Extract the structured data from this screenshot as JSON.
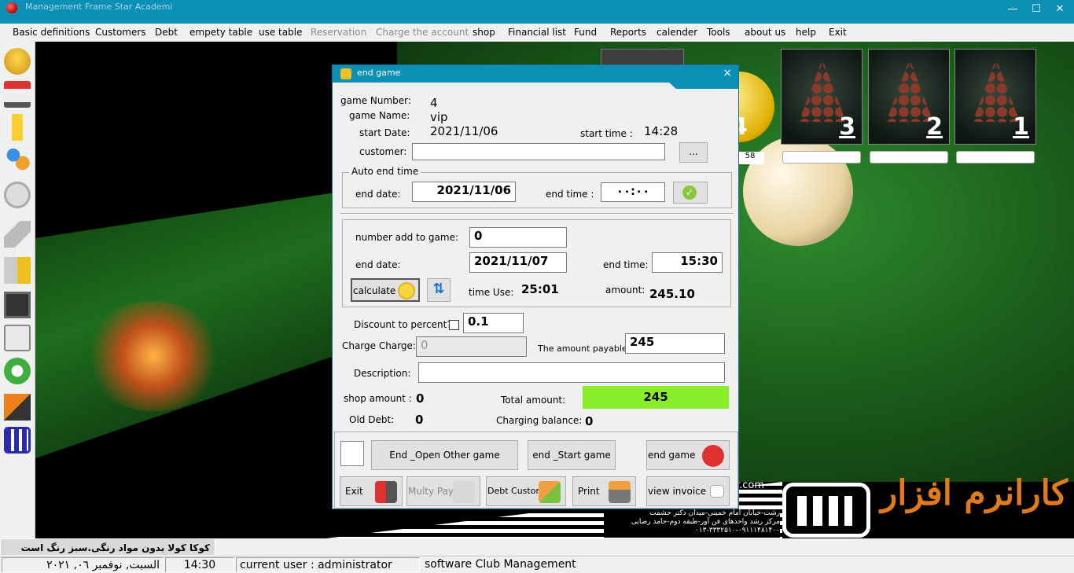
{
  "window": {
    "title": "Management Frame Star Academi",
    "minimize": "—",
    "maximize": "☐",
    "close": "✕"
  },
  "menu": [
    {
      "label": "Basic definitions",
      "enabled": true
    },
    {
      "label": "Customers",
      "enabled": true
    },
    {
      "label": "Debt",
      "enabled": true
    },
    {
      "label": "empety table",
      "enabled": true
    },
    {
      "label": "use table",
      "enabled": true
    },
    {
      "label": "Reservation",
      "enabled": false
    },
    {
      "label": "Charge the account",
      "enabled": false
    },
    {
      "label": "shop",
      "enabled": true
    },
    {
      "label": "Financial list",
      "enabled": true
    },
    {
      "label": "Fund",
      "enabled": true
    },
    {
      "label": "Reports",
      "enabled": true
    },
    {
      "label": "calender",
      "enabled": true
    },
    {
      "label": "Tools",
      "enabled": true
    },
    {
      "label": "about us",
      "enabled": true
    },
    {
      "label": "help",
      "enabled": true
    },
    {
      "label": "Exit",
      "enabled": true
    }
  ],
  "toolbar_icons": [
    "coins-icon",
    "shopping-cart-icon",
    "drink-icon",
    "users-icon",
    "clock-icon",
    "tag-icon",
    "customer-report-icon",
    "save-icon",
    "calculator-icon",
    "refresh-icon",
    "k-logo-icon",
    "brand-logo-icon"
  ],
  "tables": [
    {
      "number": "3"
    },
    {
      "number": "2"
    },
    {
      "number": "1"
    }
  ],
  "partial_table": {
    "number": "4",
    "label": "58"
  },
  "dialog": {
    "title": "end game",
    "close": "×",
    "game_number_label": "game Number:",
    "game_number": "4",
    "game_name_label": "game Name:",
    "game_name": "vip",
    "start_date_label": "start Date:",
    "start_date": "2021/11/06",
    "start_time_label": "start time :",
    "start_time": "14:28",
    "customer_label": "customer:",
    "customer_value": "",
    "browse_label": "...",
    "auto_end": {
      "legend": "Auto end time",
      "end_date_label": "end date:",
      "end_date": "2021/11/06",
      "end_time_label": "end time :",
      "end_time": "۰۰:۰۰"
    },
    "calc": {
      "number_add_label": "number add to game:",
      "number_add": "0",
      "end_date_label": "end date:",
      "end_date": "2021/11/07",
      "end_time_label": "end time:",
      "end_time": "15:30",
      "calculate_label": "calculate",
      "time_use_label": "time Use:",
      "time_use": "25:01",
      "amount_label": "amount:",
      "amount": "245.10"
    },
    "discount_label": "Discount to percent?",
    "discount_value": "0.1",
    "charge_label": "Charge Charge:",
    "charge_value": "0",
    "payable_label": "The amount payable:",
    "payable_value": "245",
    "description_label": "Description:",
    "description_value": "",
    "shop_amount_label": "shop amount :",
    "shop_amount": "0",
    "total_label": "Total amount:",
    "total_value": "245",
    "old_debt_label": "Old Debt:",
    "old_debt": "0",
    "charging_balance_label": "Charging balance:",
    "charging_balance": "0",
    "buttons": {
      "end_open_other": "End _Open Other game",
      "end_start": "end _Start game",
      "end_game": "end game",
      "exit": "Exit",
      "multy_pay": "Multy Pay",
      "debt_customer": "Debt Customer",
      "print": "Print",
      "view_invoice": "view invoice"
    }
  },
  "branding": {
    "website": "r.com",
    "address_line1": "رشت-خیابان امام خمینی-میدان دکتر حشمت",
    "address_line2": "مرکز رشد واحدهای فن آور-طبقه دوم-حامد رضایی",
    "phones": "۰۱۳-۳۳۳۲۵۱۰-۰۹۱۱۱۴۸۱۴۰۰",
    "brand_text": "کارانرم افزار"
  },
  "marquee": "کوکا کولا بدون مواد رنگی.سبز رنگ است",
  "status": {
    "date": "السبت, نوفمبر ۰٦, ۲۰۲۱",
    "time": "14:30",
    "user": "current user : administrator",
    "software": "software Club Management"
  }
}
